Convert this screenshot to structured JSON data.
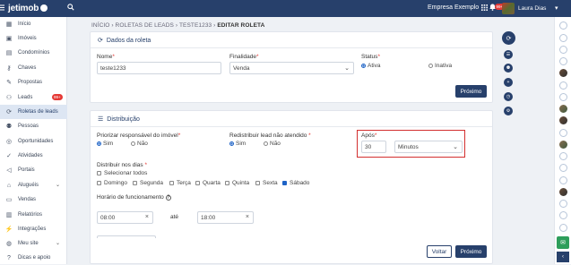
{
  "app": {
    "logo": "jetimob",
    "company": "Empresa Exemplo",
    "user_name": "Laura Dias",
    "notification_count": "99+"
  },
  "sidebar": {
    "items": [
      {
        "label": "Início",
        "icon": "grid-icon"
      },
      {
        "label": "Imóveis",
        "icon": "image-icon"
      },
      {
        "label": "Condomínios",
        "icon": "building-icon"
      },
      {
        "label": "Chaves",
        "icon": "key-icon"
      },
      {
        "label": "Propostas",
        "icon": "gavel-icon"
      },
      {
        "label": "Leads",
        "icon": "leads-icon",
        "badge": "99+"
      },
      {
        "label": "Roletas de leads",
        "icon": "roulette-icon",
        "active": true
      },
      {
        "label": "Pessoas",
        "icon": "people-icon"
      },
      {
        "label": "Oportunidades",
        "icon": "target-icon"
      },
      {
        "label": "Atividades",
        "icon": "check-circle-icon"
      },
      {
        "label": "Portais",
        "icon": "megaphone-icon"
      },
      {
        "label": "Aluguéis",
        "icon": "house-key-icon"
      },
      {
        "label": "Vendas",
        "icon": "cash-icon"
      },
      {
        "label": "Relatórios",
        "icon": "report-icon"
      },
      {
        "label": "Integrações",
        "icon": "plug-icon"
      },
      {
        "label": "Meu site",
        "icon": "globe-icon"
      },
      {
        "label": "Dicas e apoio",
        "icon": "help-icon"
      }
    ]
  },
  "breadcrumb": {
    "items": [
      "INÍCIO",
      "ROLETAS DE LEADS",
      "TESTE1233",
      "EDITAR ROLETA"
    ],
    "sep": "›"
  },
  "dados": {
    "title": "Dados da roleta",
    "nome_label": "Nome",
    "nome_value": "teste1233",
    "finalidade_label": "Finalidade",
    "finalidade_value": "Venda",
    "status_label": "Status",
    "status_ativa": "Ativa",
    "status_inativa": "Inativa",
    "next_button": "Próximo"
  },
  "distribuicao": {
    "title": "Distribuição",
    "priorizar_label": "Priorizar responsável do imóvel",
    "redistribuir_label": "Redistribuir lead não atendido",
    "sim": "Sim",
    "nao": "Não",
    "apos_label": "Após",
    "apos_value": "30",
    "apos_unit": "Minutos",
    "dias_label": "Distribuir nos dias",
    "selecionar_todos": "Selecionar todos",
    "days": [
      {
        "label": "Domingo",
        "checked": false
      },
      {
        "label": "Segunda",
        "checked": false
      },
      {
        "label": "Terça",
        "checked": false
      },
      {
        "label": "Quarta",
        "checked": false
      },
      {
        "label": "Quinta",
        "checked": false
      },
      {
        "label": "Sexta",
        "checked": false
      },
      {
        "label": "Sábado",
        "checked": true
      }
    ],
    "horario_label": "Horário de funcionamento",
    "inicio": "08:00",
    "ate": "até",
    "fim": "18:00"
  },
  "footer": {
    "voltar": "Voltar",
    "proximo": "Próximo"
  },
  "colors": {
    "primary": "#27406b",
    "accent_blue": "#1e63c6",
    "highlight_red": "#d32f2f",
    "badge_red": "#e53935",
    "chat_green": "#2e9e5b"
  }
}
